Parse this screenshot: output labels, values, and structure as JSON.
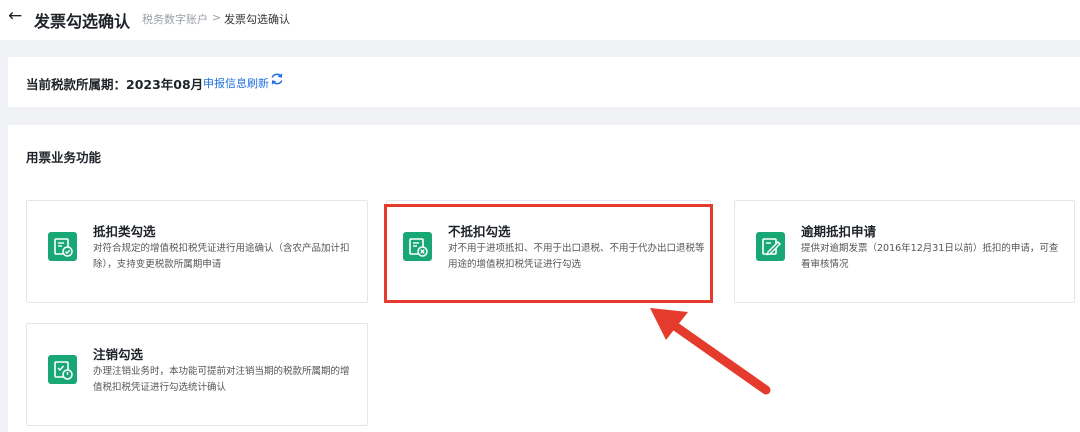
{
  "header": {
    "back_icon": "arrow-left-icon",
    "title": "发票勾选确认",
    "breadcrumb": [
      "税务数字账户",
      ">",
      "发票勾选确认"
    ]
  },
  "period": {
    "label": "当前税款所属期：2023年08月",
    "link": "申报信息刷新",
    "refresh_icon": "refresh-icon"
  },
  "functions": {
    "title": "用票业务功能",
    "cards": [
      {
        "title": "抵扣类勾选",
        "desc": "对符合规定的增值税扣税凭证进行用途确认（含农产品加计扣除），支持变更税款所属期申请",
        "icon": "invoice-check-icon"
      },
      {
        "title": "不抵扣勾选",
        "desc": "对不用于进项抵扣、不用于出口退税、不用于代办出口退税等用途的增值税扣税凭证进行勾选",
        "icon": "invoice-cancel-icon"
      },
      {
        "title": "逾期抵扣申请",
        "desc": "提供对逾期发票（2016年12月31日以前）抵扣的申请，可查看审核情况",
        "icon": "edit-invoice-icon"
      },
      {
        "title": "注销勾选",
        "desc": "办理注销业务时，本功能可提前对注销当期的税款所属期的增值税扣税凭证进行勾选统计确认",
        "icon": "invoice-power-icon"
      }
    ]
  },
  "annotation": {
    "highlight_color": "#e53b2c",
    "arrow_color": "#e53b2c"
  },
  "colors": {
    "accent": "#1aa776",
    "link": "#1f6fe0"
  }
}
